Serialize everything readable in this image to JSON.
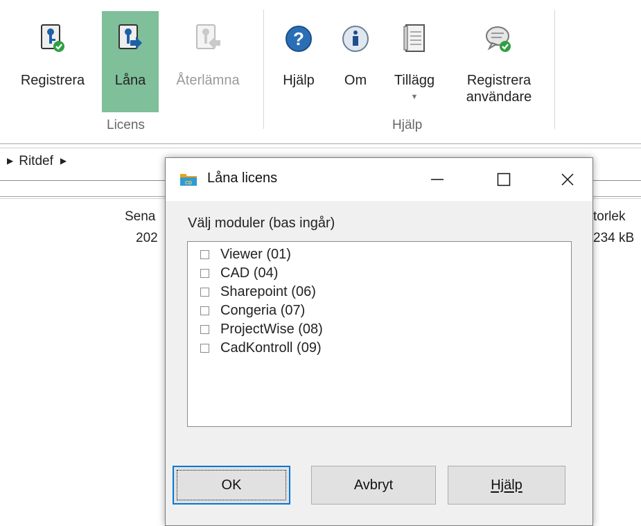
{
  "ribbon": {
    "licens_group": {
      "label": "Licens",
      "buttons": [
        {
          "label": "Registrera",
          "icon": "register-license-icon"
        },
        {
          "label": "Låna",
          "icon": "borrow-license-icon"
        },
        {
          "label": "Återlämna",
          "icon": "return-license-icon"
        }
      ]
    },
    "hjalp_group": {
      "label": "Hjälp",
      "buttons": [
        {
          "label": "Hjälp",
          "icon": "help-question-icon"
        },
        {
          "label": "Om",
          "icon": "info-icon"
        },
        {
          "label": "Tillägg",
          "icon": "notebook-icon"
        },
        {
          "label_line1": "Registrera",
          "label_line2": "användare",
          "icon": "chat-check-icon"
        }
      ]
    },
    "colors": {
      "active_bg": "#7fbf9a",
      "help_blue": "#2a6fb5",
      "check_green": "#2ea043"
    }
  },
  "breadcrumb": {
    "item": "Ritdef"
  },
  "background_table": {
    "col_left_header": "Sena",
    "col_left_value": "202",
    "col_right_header": "torlek",
    "col_right_value": "234 kB"
  },
  "dialog": {
    "title": "Låna licens",
    "prompt": "Välj moduler (bas ingår)",
    "modules": [
      {
        "label": "Viewer (01)",
        "checked": false
      },
      {
        "label": "CAD (04)",
        "checked": false
      },
      {
        "label": "Sharepoint (06)",
        "checked": false
      },
      {
        "label": "Congeria (07)",
        "checked": false
      },
      {
        "label": "ProjectWise (08)",
        "checked": false
      },
      {
        "label": "CadKontroll (09)",
        "checked": false
      }
    ],
    "buttons": {
      "ok": "OK",
      "cancel": "Avbryt",
      "help": "Hjälp"
    }
  }
}
